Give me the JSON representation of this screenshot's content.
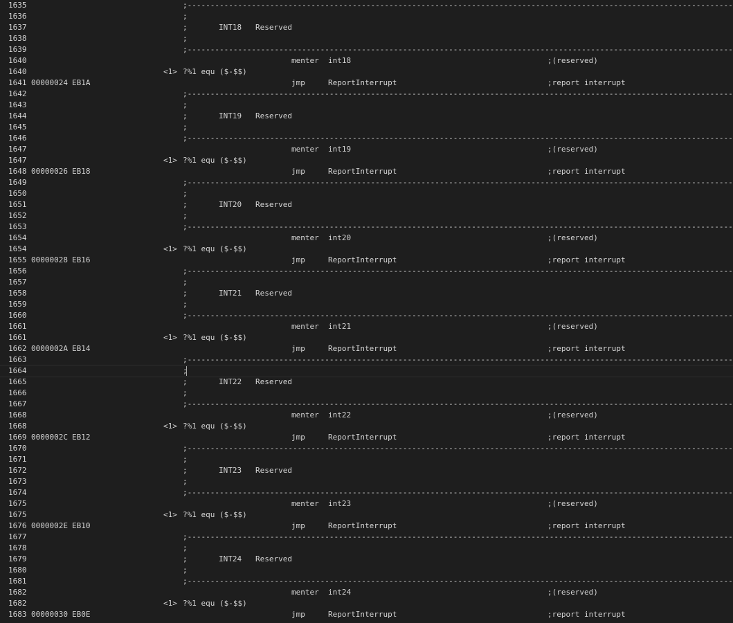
{
  "editor": {
    "separator": ";----------------------------------------------------------------------------------------------------------------------------",
    "cursor_line": "1664",
    "lines": [
      {
        "ln": "1635",
        "kind": "sep"
      },
      {
        "ln": "1636",
        "kind": "semi",
        "lbl": ";"
      },
      {
        "ln": "1637",
        "kind": "header",
        "lbl": ";",
        "txt": "INT18   Reserved"
      },
      {
        "ln": "1638",
        "kind": "semi",
        "lbl": ";"
      },
      {
        "ln": "1639",
        "kind": "sep"
      },
      {
        "ln": "1640",
        "kind": "code",
        "mn": "menter",
        "op": "int18",
        "cmt": ";(reserved)"
      },
      {
        "ln": "1640",
        "kind": "macro",
        "lvl": "<1>",
        "lbl": "?%1 equ ($-$$)"
      },
      {
        "ln": "1641",
        "kind": "code",
        "off": "00000024",
        "hex": "EB1A",
        "mn": "jmp",
        "op": "ReportInterrupt",
        "cmt": ";report interrupt"
      },
      {
        "ln": "1642",
        "kind": "sep"
      },
      {
        "ln": "1643",
        "kind": "semi",
        "lbl": ";"
      },
      {
        "ln": "1644",
        "kind": "header",
        "lbl": ";",
        "txt": "INT19   Reserved"
      },
      {
        "ln": "1645",
        "kind": "semi",
        "lbl": ";"
      },
      {
        "ln": "1646",
        "kind": "sep"
      },
      {
        "ln": "1647",
        "kind": "code",
        "mn": "menter",
        "op": "int19",
        "cmt": ";(reserved)"
      },
      {
        "ln": "1647",
        "kind": "macro",
        "lvl": "<1>",
        "lbl": "?%1 equ ($-$$)"
      },
      {
        "ln": "1648",
        "kind": "code",
        "off": "00000026",
        "hex": "EB18",
        "mn": "jmp",
        "op": "ReportInterrupt",
        "cmt": ";report interrupt"
      },
      {
        "ln": "1649",
        "kind": "sep"
      },
      {
        "ln": "1650",
        "kind": "semi",
        "lbl": ";"
      },
      {
        "ln": "1651",
        "kind": "header",
        "lbl": ";",
        "txt": "INT20   Reserved"
      },
      {
        "ln": "1652",
        "kind": "semi",
        "lbl": ";"
      },
      {
        "ln": "1653",
        "kind": "sep"
      },
      {
        "ln": "1654",
        "kind": "code",
        "mn": "menter",
        "op": "int20",
        "cmt": ";(reserved)"
      },
      {
        "ln": "1654",
        "kind": "macro",
        "lvl": "<1>",
        "lbl": "?%1 equ ($-$$)"
      },
      {
        "ln": "1655",
        "kind": "code",
        "off": "00000028",
        "hex": "EB16",
        "mn": "jmp",
        "op": "ReportInterrupt",
        "cmt": ";report interrupt"
      },
      {
        "ln": "1656",
        "kind": "sep"
      },
      {
        "ln": "1657",
        "kind": "semi",
        "lbl": ";"
      },
      {
        "ln": "1658",
        "kind": "header",
        "lbl": ";",
        "txt": "INT21   Reserved"
      },
      {
        "ln": "1659",
        "kind": "semi",
        "lbl": ";"
      },
      {
        "ln": "1660",
        "kind": "sep"
      },
      {
        "ln": "1661",
        "kind": "code",
        "mn": "menter",
        "op": "int21",
        "cmt": ";(reserved)"
      },
      {
        "ln": "1661",
        "kind": "macro",
        "lvl": "<1>",
        "lbl": "?%1 equ ($-$$)"
      },
      {
        "ln": "1662",
        "kind": "code",
        "off": "0000002A",
        "hex": "EB14",
        "mn": "jmp",
        "op": "ReportInterrupt",
        "cmt": ";report interrupt"
      },
      {
        "ln": "1663",
        "kind": "sep"
      },
      {
        "ln": "1664",
        "kind": "semi",
        "lbl": ";"
      },
      {
        "ln": "1665",
        "kind": "header",
        "lbl": ";",
        "txt": "INT22   Reserved"
      },
      {
        "ln": "1666",
        "kind": "semi",
        "lbl": ";"
      },
      {
        "ln": "1667",
        "kind": "sep"
      },
      {
        "ln": "1668",
        "kind": "code",
        "mn": "menter",
        "op": "int22",
        "cmt": ";(reserved)"
      },
      {
        "ln": "1668",
        "kind": "macro",
        "lvl": "<1>",
        "lbl": "?%1 equ ($-$$)"
      },
      {
        "ln": "1669",
        "kind": "code",
        "off": "0000002C",
        "hex": "EB12",
        "mn": "jmp",
        "op": "ReportInterrupt",
        "cmt": ";report interrupt"
      },
      {
        "ln": "1670",
        "kind": "sep"
      },
      {
        "ln": "1671",
        "kind": "semi",
        "lbl": ";"
      },
      {
        "ln": "1672",
        "kind": "header",
        "lbl": ";",
        "txt": "INT23   Reserved"
      },
      {
        "ln": "1673",
        "kind": "semi",
        "lbl": ";"
      },
      {
        "ln": "1674",
        "kind": "sep"
      },
      {
        "ln": "1675",
        "kind": "code",
        "mn": "menter",
        "op": "int23",
        "cmt": ";(reserved)"
      },
      {
        "ln": "1675",
        "kind": "macro",
        "lvl": "<1>",
        "lbl": "?%1 equ ($-$$)"
      },
      {
        "ln": "1676",
        "kind": "code",
        "off": "0000002E",
        "hex": "EB10",
        "mn": "jmp",
        "op": "ReportInterrupt",
        "cmt": ";report interrupt"
      },
      {
        "ln": "1677",
        "kind": "sep"
      },
      {
        "ln": "1678",
        "kind": "semi",
        "lbl": ";"
      },
      {
        "ln": "1679",
        "kind": "header",
        "lbl": ";",
        "txt": "INT24   Reserved"
      },
      {
        "ln": "1680",
        "kind": "semi",
        "lbl": ";"
      },
      {
        "ln": "1681",
        "kind": "sep"
      },
      {
        "ln": "1682",
        "kind": "code",
        "mn": "menter",
        "op": "int24",
        "cmt": ";(reserved)"
      },
      {
        "ln": "1682",
        "kind": "macro",
        "lvl": "<1>",
        "lbl": "?%1 equ ($-$$)"
      },
      {
        "ln": "1683",
        "kind": "code",
        "off": "00000030",
        "hex": "EB0E",
        "mn": "jmp",
        "op": "ReportInterrupt",
        "cmt": ";report interrupt"
      }
    ]
  }
}
